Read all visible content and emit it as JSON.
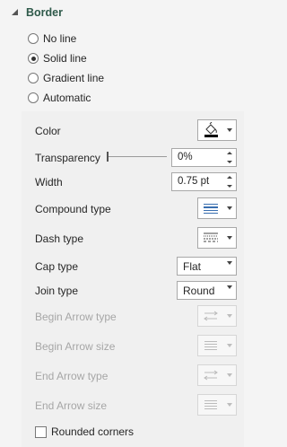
{
  "section": {
    "title": "Border"
  },
  "line_options": [
    {
      "label": "No line",
      "checked": false
    },
    {
      "label": "Solid line",
      "checked": true
    },
    {
      "label": "Gradient line",
      "checked": false
    },
    {
      "label": "Automatic",
      "checked": false
    }
  ],
  "props": {
    "color_label": "Color",
    "transparency_label": "Transparency",
    "transparency_value": "0%",
    "width_label": "Width",
    "width_value": "0.75 pt",
    "compound_label": "Compound type",
    "dash_label": "Dash type",
    "cap_label": "Cap type",
    "cap_value": "Flat",
    "join_label": "Join type",
    "join_value": "Round",
    "begin_arrow_type_label": "Begin Arrow type",
    "begin_arrow_size_label": "Begin Arrow size",
    "end_arrow_type_label": "End Arrow type",
    "end_arrow_size_label": "End Arrow size",
    "rounded_label": "Rounded corners"
  },
  "colors": {
    "header": "#2f5a4a",
    "pane": "#f4f4f4",
    "disabled_text": "#a6a6a6",
    "border_color_swatch": "#000000"
  }
}
